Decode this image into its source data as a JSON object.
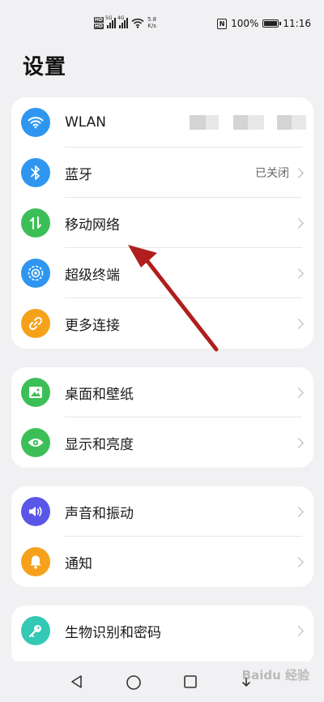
{
  "status_bar": {
    "hd1": "HD",
    "hd2": "HD",
    "sig1_tag": "5G",
    "sig2_tag": "4G",
    "speed_value": "5.8",
    "speed_unit": "K/s",
    "nfc": "N",
    "battery": "100%",
    "time": "11:16"
  },
  "page": {
    "title": "设置"
  },
  "groups": [
    {
      "items": [
        {
          "label": "WLAN",
          "value": "",
          "icon": "wifi-icon",
          "color": "#2e96f0"
        },
        {
          "label": "蓝牙",
          "value": "已关闭",
          "icon": "bluetooth-icon",
          "color": "#2e96f0"
        },
        {
          "label": "移动网络",
          "value": "",
          "icon": "mobile-data-icon",
          "color": "#3dbf58"
        },
        {
          "label": "超级终端",
          "value": "",
          "icon": "super-device-icon",
          "color": "#2e96f0"
        },
        {
          "label": "更多连接",
          "value": "",
          "icon": "link-icon",
          "color": "#f5a11a"
        }
      ]
    },
    {
      "items": [
        {
          "label": "桌面和壁纸",
          "value": "",
          "icon": "wallpaper-icon",
          "color": "#3dbf58"
        },
        {
          "label": "显示和亮度",
          "value": "",
          "icon": "eye-icon",
          "color": "#3dbf58"
        }
      ]
    },
    {
      "items": [
        {
          "label": "声音和振动",
          "value": "",
          "icon": "speaker-icon",
          "color": "#5a57e8"
        },
        {
          "label": "通知",
          "value": "",
          "icon": "bell-icon",
          "color": "#f5a11a"
        }
      ]
    },
    {
      "items": [
        {
          "label": "生物识别和密码",
          "value": "",
          "icon": "key-icon",
          "color": "#33c9b4"
        }
      ]
    }
  ],
  "nav": {
    "back": "back-icon",
    "home": "home-icon",
    "recents": "recents-icon"
  },
  "watermark": "Baidu 经验",
  "annotation": {
    "color": "#b01e1e"
  }
}
